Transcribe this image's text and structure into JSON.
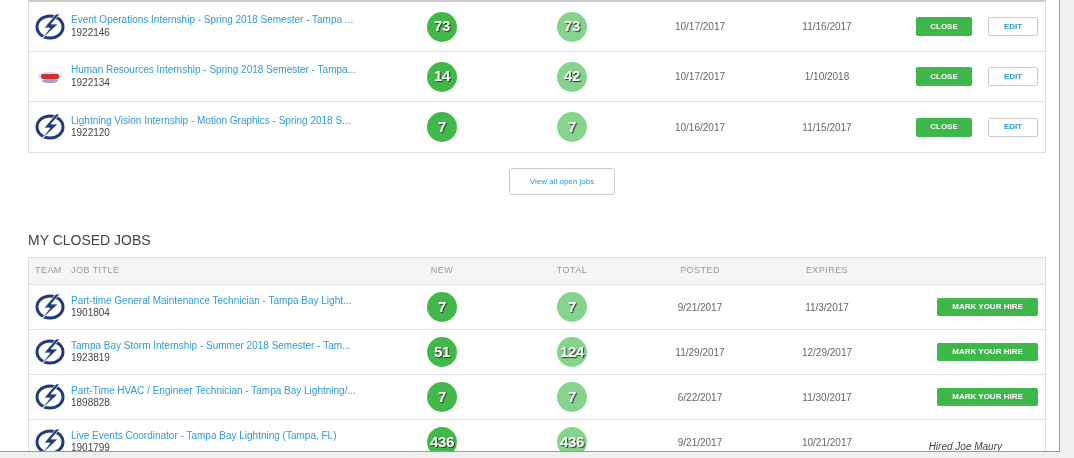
{
  "open_jobs": {
    "rows": [
      {
        "logo": {
          "kind": "bolt"
        },
        "title": "Event Operations Internship - Spring 2018 Semester - Tampa ...",
        "id": "1922146",
        "new": "73",
        "total": "73",
        "posted": "10/17/2017",
        "expires": "11/16/2017",
        "close": "CLOSE",
        "edit": "EDIT"
      },
      {
        "logo": {
          "kind": "oval"
        },
        "title": "Human Resources Internship - Spring 2018 Semester - Tampa...",
        "id": "1922134",
        "new": "14",
        "total": "42",
        "posted": "10/17/2017",
        "expires": "1/10/2018",
        "close": "CLOSE",
        "edit": "EDIT"
      },
      {
        "logo": {
          "kind": "bolt"
        },
        "title": "Lightning Vision Internship - Motion Graphics - Spring 2018 S...",
        "id": "1922120",
        "new": "7",
        "total": "7",
        "posted": "10/16/2017",
        "expires": "11/15/2017",
        "close": "CLOSE",
        "edit": "EDIT"
      }
    ],
    "view_all": "View all open jobs"
  },
  "closed_jobs": {
    "heading": "MY CLOSED JOBS",
    "columns": [
      "TEAM",
      "JOB TITLE",
      "NEW",
      "TOTAL",
      "POSTED",
      "EXPIRES"
    ],
    "rows": [
      {
        "logo": {
          "kind": "bolt"
        },
        "title": "Part-time General Maintenance Technician - Tampa Bay Light...",
        "id": "1901804",
        "new": "7",
        "total": "7",
        "posted": "9/21/2017",
        "expires": "11/3/2017",
        "action": {
          "kind": "button",
          "text": "MARK YOUR HIRE"
        }
      },
      {
        "logo": {
          "kind": "bolt"
        },
        "title": "Tampa Bay Storm Internship - Summer 2018 Semester - Tam...",
        "id": "1923819",
        "new": "51",
        "total": "124",
        "posted": "11/29/2017",
        "expires": "12/29/2017",
        "action": {
          "kind": "button",
          "text": "MARK YOUR HIRE"
        }
      },
      {
        "logo": {
          "kind": "bolt"
        },
        "title": "Part-Time HVAC / Engineer Technician - Tampa Bay Lightning/...",
        "id": "1898828",
        "new": "7",
        "total": "7",
        "posted": "6/22/2017",
        "expires": "11/30/2017",
        "action": {
          "kind": "button",
          "text": "MARK YOUR HIRE"
        }
      },
      {
        "logo": {
          "kind": "bolt"
        },
        "title": "Live Events Coordinator - Tampa Bay Lightning (Tampa, FL)",
        "id": "1901799",
        "new": "436",
        "total": "436",
        "posted": "9/21/2017",
        "expires": "10/21/2017",
        "action": {
          "kind": "text",
          "text": "Hired Joe Maury"
        }
      }
    ]
  }
}
